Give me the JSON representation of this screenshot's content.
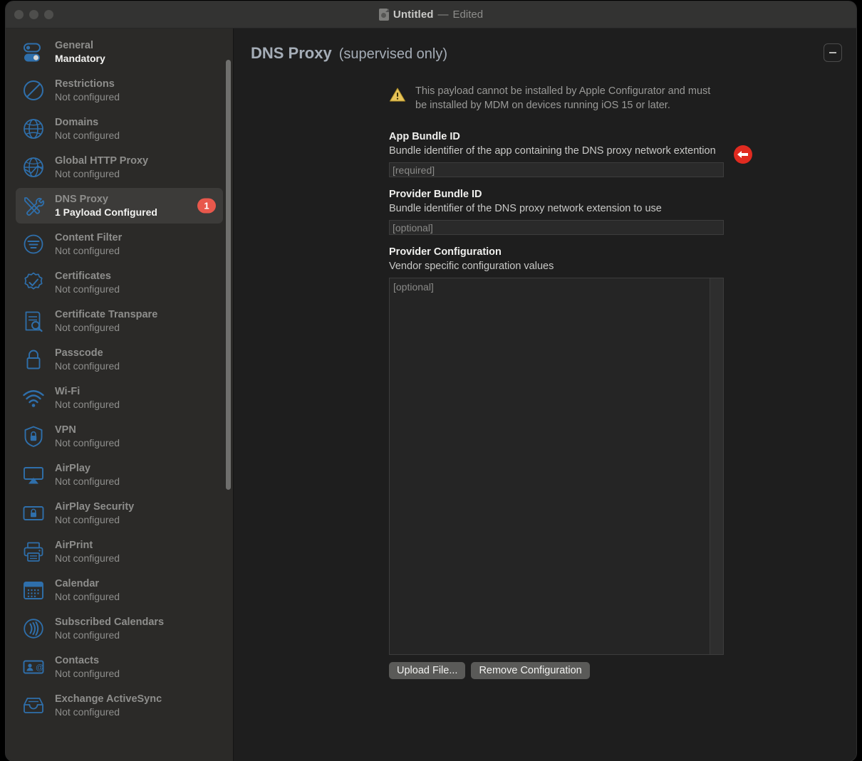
{
  "window": {
    "title": "Untitled",
    "separator": "—",
    "state": "Edited",
    "traffic_lights": [
      "close",
      "minimize",
      "zoom"
    ]
  },
  "sidebar": {
    "items": [
      {
        "icon": "toggle-switches-icon",
        "label": "General",
        "status": "Mandatory",
        "status_strong": true,
        "selected": false
      },
      {
        "icon": "no-entry-icon",
        "label": "Restrictions",
        "status": "Not configured",
        "status_strong": false,
        "selected": false
      },
      {
        "icon": "globe-icon",
        "label": "Domains",
        "status": "Not configured",
        "status_strong": false,
        "selected": false
      },
      {
        "icon": "globe-proxy-icon",
        "label": "Global HTTP Proxy",
        "status": "Not configured",
        "status_strong": false,
        "selected": false
      },
      {
        "icon": "tools-icon",
        "label": "DNS Proxy",
        "status": "1 Payload Configured",
        "status_strong": true,
        "selected": true,
        "badge": "1"
      },
      {
        "icon": "content-filter-icon",
        "label": "Content Filter",
        "status": "Not configured",
        "status_strong": false,
        "selected": false
      },
      {
        "icon": "certificate-seal-icon",
        "label": "Certificates",
        "status": "Not configured",
        "status_strong": false,
        "selected": false
      },
      {
        "icon": "certificate-search-icon",
        "label": "Certificate Transpare",
        "status": "Not configured",
        "status_strong": false,
        "selected": false
      },
      {
        "icon": "lock-icon",
        "label": "Passcode",
        "status": "Not configured",
        "status_strong": false,
        "selected": false
      },
      {
        "icon": "wifi-icon",
        "label": "Wi-Fi",
        "status": "Not configured",
        "status_strong": false,
        "selected": false
      },
      {
        "icon": "shield-lock-icon",
        "label": "VPN",
        "status": "Not configured",
        "status_strong": false,
        "selected": false
      },
      {
        "icon": "airplay-icon",
        "label": "AirPlay",
        "status": "Not configured",
        "status_strong": false,
        "selected": false
      },
      {
        "icon": "airplay-security-icon",
        "label": "AirPlay Security",
        "status": "Not configured",
        "status_strong": false,
        "selected": false
      },
      {
        "icon": "printer-icon",
        "label": "AirPrint",
        "status": "Not configured",
        "status_strong": false,
        "selected": false
      },
      {
        "icon": "calendar-icon",
        "label": "Calendar",
        "status": "Not configured",
        "status_strong": false,
        "selected": false
      },
      {
        "icon": "broadcast-icon",
        "label": "Subscribed Calendars",
        "status": "Not configured",
        "status_strong": false,
        "selected": false
      },
      {
        "icon": "contact-card-icon",
        "label": "Contacts",
        "status": "Not configured",
        "status_strong": false,
        "selected": false
      },
      {
        "icon": "inbox-icon",
        "label": "Exchange ActiveSync",
        "status": "Not configured",
        "status_strong": false,
        "selected": false
      }
    ]
  },
  "main": {
    "page_title": "DNS Proxy",
    "page_subtitle": "(supervised only)",
    "collapse_button_label": "−",
    "warning": "This payload cannot be installed by Apple Configurator and must be installed by MDM on devices running iOS 15 or later.",
    "fields": [
      {
        "label": "App Bundle ID",
        "description": "Bundle identifier of the app containing the DNS proxy network extention",
        "placeholder": "[required]",
        "value": "",
        "required_marker": true
      },
      {
        "label": "Provider Bundle ID",
        "description": "Bundle identifier of the DNS proxy network extension to use",
        "placeholder": "[optional]",
        "value": "",
        "required_marker": false
      },
      {
        "label": "Provider Configuration",
        "description": "Vendor specific configuration values",
        "placeholder": "[optional]",
        "value": "",
        "required_marker": false
      }
    ],
    "buttons": {
      "upload": "Upload File...",
      "remove": "Remove Configuration"
    }
  },
  "colors": {
    "accent_blue": "#2f6fab",
    "badge_red": "#e8584c",
    "warning_yellow": "#e8c45a",
    "window_bg": "#1e1e1e",
    "sidebar_bg": "#2b2a28"
  }
}
